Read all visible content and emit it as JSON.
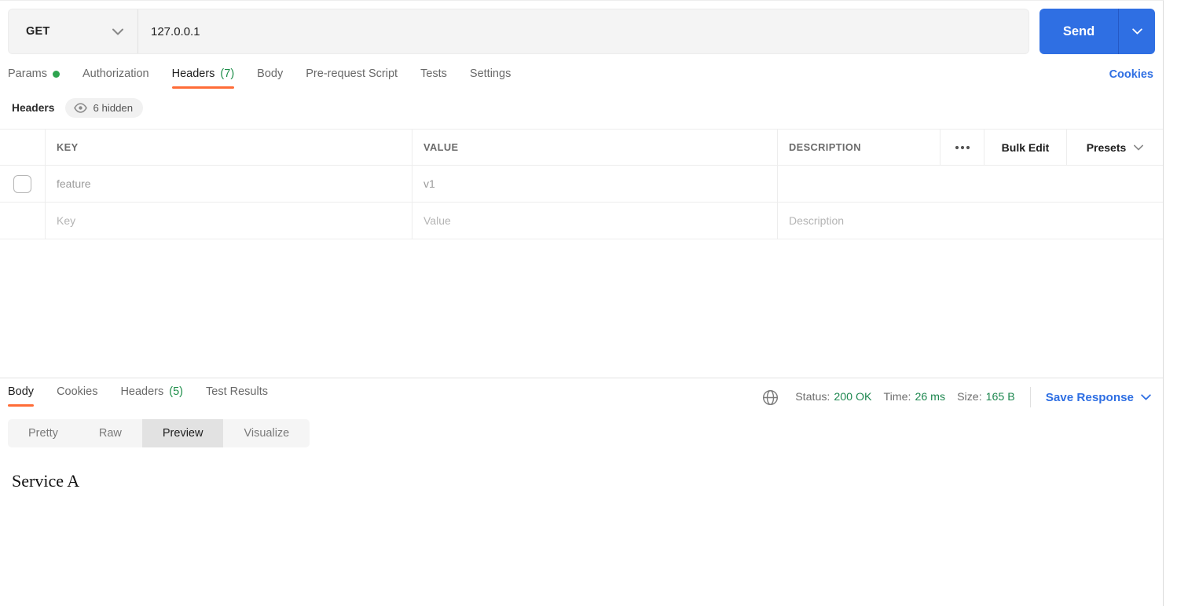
{
  "request": {
    "method": "GET",
    "url": "127.0.0.1",
    "send_label": "Send",
    "tabs": [
      {
        "label": "Params",
        "has_dot": true
      },
      {
        "label": "Authorization"
      },
      {
        "label": "Headers",
        "badge": "(7)",
        "active": true
      },
      {
        "label": "Body"
      },
      {
        "label": "Pre-request Script"
      },
      {
        "label": "Tests"
      },
      {
        "label": "Settings"
      }
    ],
    "cookies_link": "Cookies"
  },
  "headers_editor": {
    "title": "Headers",
    "hidden_badge": "6 hidden",
    "columns": {
      "key": "KEY",
      "value": "VALUE",
      "description": "DESCRIPTION"
    },
    "bulk_edit_label": "Bulk Edit",
    "presets_label": "Presets",
    "rows": [
      {
        "key": "feature",
        "value": "v1",
        "description": "",
        "checked": false
      }
    ],
    "placeholder_row": {
      "key": "Key",
      "value": "Value",
      "description": "Description"
    }
  },
  "response": {
    "tabs": [
      {
        "label": "Body",
        "active": true
      },
      {
        "label": "Cookies"
      },
      {
        "label": "Headers",
        "badge": "(5)"
      },
      {
        "label": "Test Results"
      }
    ],
    "status_label": "Status:",
    "status_value": "200 OK",
    "time_label": "Time:",
    "time_value": "26 ms",
    "size_label": "Size:",
    "size_value": "165 B",
    "save_response_label": "Save Response",
    "view_tabs": [
      {
        "label": "Pretty"
      },
      {
        "label": "Raw"
      },
      {
        "label": "Preview",
        "active": true
      },
      {
        "label": "Visualize"
      }
    ],
    "body_preview": "Service A"
  },
  "icons": {
    "chevron": "chevron-down-icon",
    "eye": "eye-icon",
    "more": "more-options-icon",
    "globe": "globe-icon"
  },
  "colors": {
    "accent_orange": "#ff6c37",
    "accent_blue": "#2f6fe3",
    "success_green": "#1d874f",
    "dot_green": "#2ea44f"
  }
}
